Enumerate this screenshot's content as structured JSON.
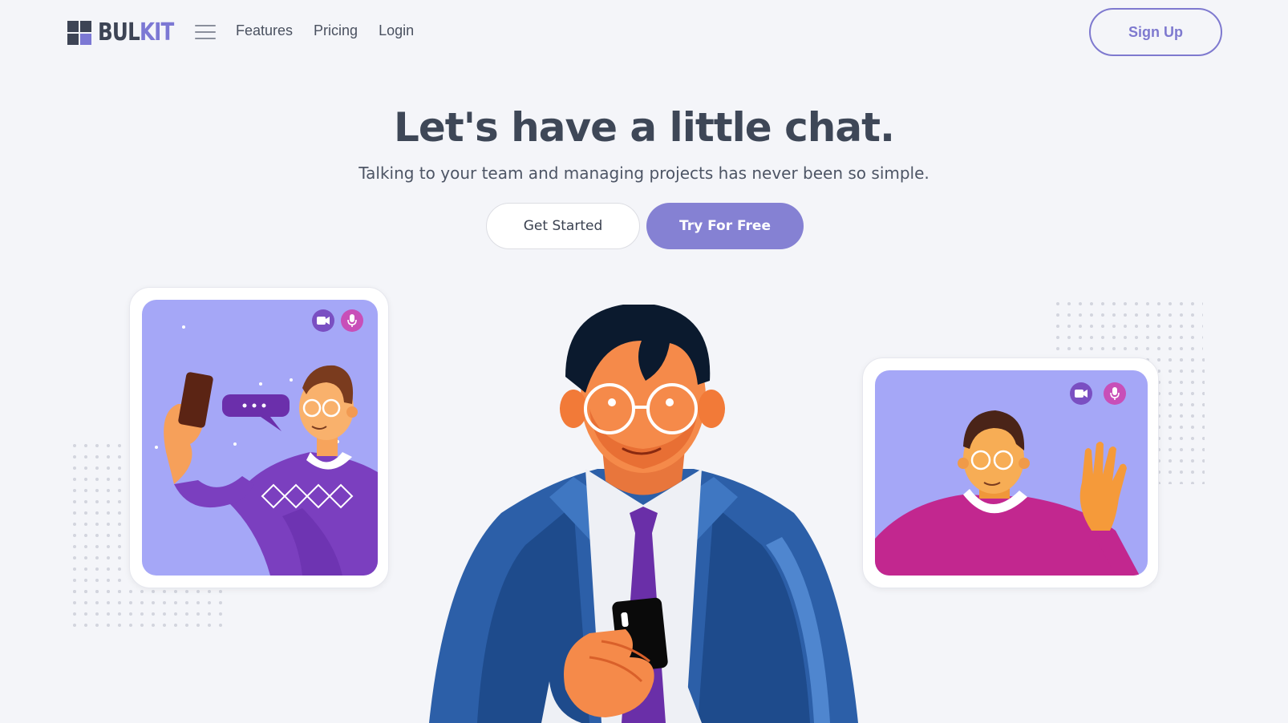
{
  "brand": {
    "logo_part1": "BUL",
    "logo_part2": "KIT"
  },
  "nav": {
    "links": [
      "Features",
      "Pricing",
      "Login"
    ],
    "signup_label": "Sign Up"
  },
  "hero": {
    "title": "Let's have a little chat.",
    "subtitle": "Talking to your team and managing projects has never been so simple.",
    "primary_button": "Get Started",
    "secondary_button": "Try For Free"
  },
  "colors": {
    "accent": "#8581d3",
    "background": "#f4f5f9",
    "heading": "#3e4757",
    "card_bg": "#a5a7f7"
  },
  "icons": [
    "menu-icon",
    "video-camera-icon",
    "microphone-icon"
  ]
}
